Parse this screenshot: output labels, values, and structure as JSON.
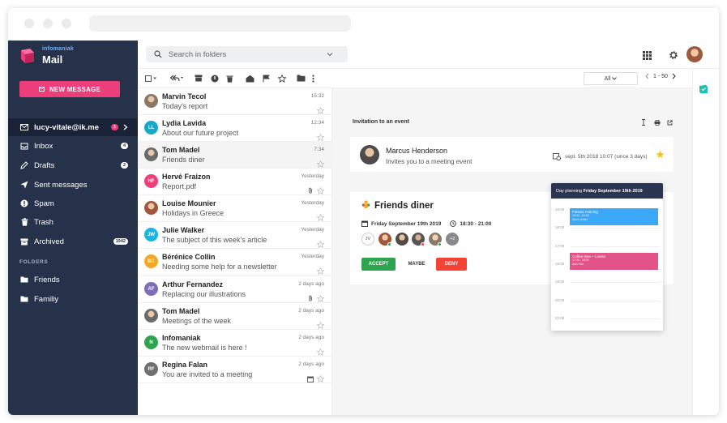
{
  "app": {
    "brand_small": "infomaniak",
    "brand": "Mail",
    "new_message": "NEW MESSAGE"
  },
  "sidebar": {
    "account": {
      "label": "lucy-vitale@ik.me",
      "badge": "1"
    },
    "items": [
      {
        "label": "Inbox",
        "badge": "4"
      },
      {
        "label": "Drafts",
        "badge": "2"
      },
      {
        "label": "Sent messages",
        "badge": ""
      },
      {
        "label": "Spam",
        "badge": ""
      },
      {
        "label": "Trash",
        "badge": ""
      },
      {
        "label": "Archived",
        "badge": "1942"
      }
    ],
    "folders_title": "FOLDERS",
    "folders": [
      {
        "label": "Friends"
      },
      {
        "label": "Familiy"
      }
    ]
  },
  "search": {
    "placeholder": "Search in folders"
  },
  "toolbar": {
    "filter": "All",
    "pager": "1 - 50"
  },
  "messages": [
    {
      "sender": "Marvin Tecol",
      "subject": "Today's report",
      "time": "15:32",
      "initials": "",
      "color": "#8a7765",
      "photo": true,
      "attach": false,
      "cal": false
    },
    {
      "sender": "Lydia Lavida",
      "subject": "About our future project",
      "time": "12:34",
      "initials": "LL",
      "color": "#1aa6c7",
      "photo": false,
      "attach": false,
      "cal": false
    },
    {
      "sender": "Tom Madel",
      "subject": "Friends diner",
      "time": "7:34",
      "initials": "",
      "color": "#6b6b6b",
      "photo": true,
      "attach": false,
      "cal": false
    },
    {
      "sender": "Hervé Fraizon",
      "subject": "Report.pdf",
      "time": "Yesterday",
      "initials": "HF",
      "color": "#ec3e7a",
      "photo": false,
      "attach": true,
      "cal": false
    },
    {
      "sender": "Louise Mounier",
      "subject": "Holidays in Greece",
      "time": "Yesterday",
      "initials": "",
      "color": "#a0583c",
      "photo": true,
      "attach": false,
      "cal": false
    },
    {
      "sender": "Julie Walker",
      "subject": "The subject of this week's article",
      "time": "Yesterday",
      "initials": "JW",
      "color": "#19b7e0",
      "photo": false,
      "attach": false,
      "cal": false
    },
    {
      "sender": "Bérénice Collin",
      "subject": "Needing some help for a newsletter",
      "time": "Yesterday",
      "initials": "BC",
      "color": "#f5a623",
      "photo": false,
      "attach": false,
      "cal": false
    },
    {
      "sender": "Arthur Fernandez",
      "subject": "Replacing our illustrations",
      "time": "2 days ago",
      "initials": "AF",
      "color": "#7c6fb7",
      "photo": false,
      "attach": true,
      "cal": false
    },
    {
      "sender": "Tom Madel",
      "subject": "Meetings of the week",
      "time": "2 days ago",
      "initials": "",
      "color": "#6b6b6b",
      "photo": true,
      "attach": false,
      "cal": false
    },
    {
      "sender": "Infomaniak",
      "subject": "The new webmail is here !",
      "time": "2 days ago",
      "initials": "N",
      "color": "#2ea44f",
      "photo": false,
      "attach": false,
      "cal": false
    },
    {
      "sender": "Regina Falan",
      "subject": "You are invited to a meeting",
      "time": "2 days ago",
      "initials": "RF",
      "color": "#6f6f6f",
      "photo": false,
      "attach": false,
      "cal": true
    }
  ],
  "reader": {
    "title": "Invitation to an event",
    "from_name": "Marcus Henderson",
    "from_sub": "Invites you to a meeting event",
    "date": "sept. 5th 2018 10:07 (since 3 days)",
    "event_title": "Friends diner",
    "event_date": "Friday September 19th 2019",
    "event_time": "18:30 - 21:00",
    "attendee_initials": "JV",
    "more_attendees": "+2",
    "accept": "ACCEPT",
    "maybe": "MAYBE",
    "deny": "DENY"
  },
  "planner": {
    "title_prefix": "Day planning ",
    "title_date": "Friday September 19th 2019",
    "hours": [
      "15:00",
      "16:00",
      "17:00",
      "18:00",
      "19:00",
      "20:00",
      "21:00"
    ],
    "event1_title": "Fitness Training",
    "event1_time": "15:30 - 16:30",
    "event1_place": "Sport center",
    "event2_title": "Coffee time – Louise",
    "event2_time": "17:30 - 18:30",
    "event2_place": "Irish Pub"
  },
  "colors": {
    "sidebar": "#26314a",
    "accent": "#ec3e7a",
    "accept": "#2ea44f",
    "deny": "#f44336",
    "event_blue": "#3ba7f7",
    "event_pink": "#e2538a"
  }
}
